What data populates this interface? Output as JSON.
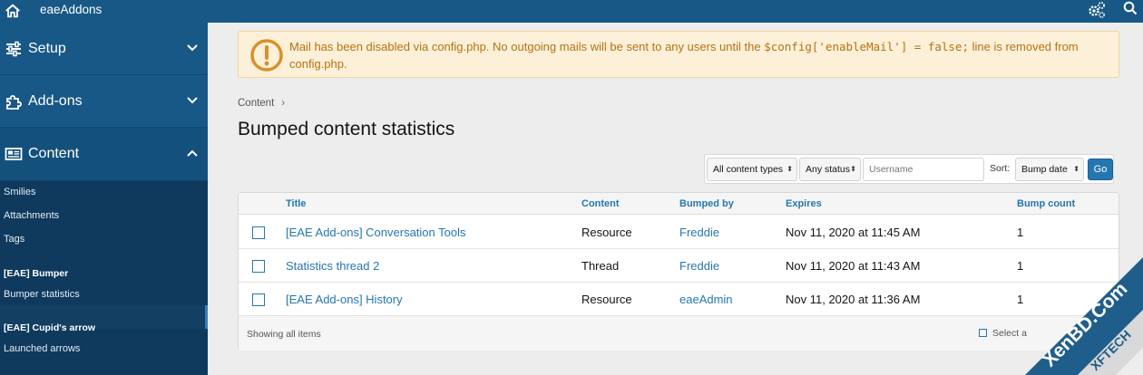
{
  "topbar": {
    "app_name": "eaeAddons"
  },
  "sidebar": {
    "sections": [
      {
        "label": "Setup",
        "icon": "sliders-icon"
      },
      {
        "label": "Add-ons",
        "icon": "puzzle-icon"
      },
      {
        "label": "Content",
        "icon": "newspaper-icon"
      }
    ],
    "items": [
      "Smilies",
      "Attachments",
      "Tags"
    ],
    "groups": [
      {
        "title": "[EAE] Bumper",
        "items": [
          "Bumper statistics"
        ]
      },
      {
        "title": "[EAE] Cupid's arrow",
        "items": [
          "Launched arrows"
        ]
      }
    ]
  },
  "alert": {
    "text_before": "Mail has been disabled via config.php. No outgoing mails will be sent to any users until the ",
    "code": "$config['enableMail'] = false;",
    "text_after": " line is removed from config.php."
  },
  "breadcrumb": "Content",
  "page_title": "Bumped content statistics",
  "filters": {
    "content_type": "All content types",
    "status": "Any status",
    "username_placeholder": "Username",
    "sort_label": "Sort:",
    "sort_value": "Bump date",
    "go_label": "Go"
  },
  "table": {
    "headers": [
      "Title",
      "Content",
      "Bumped by",
      "Expires",
      "Bump count"
    ],
    "rows": [
      {
        "title": "[EAE Add-ons] Conversation Tools",
        "content": "Resource",
        "bumped_by": "Freddie",
        "expires": "Nov 11, 2020 at 11:45 AM",
        "count": "1"
      },
      {
        "title": "Statistics thread 2",
        "content": "Thread",
        "bumped_by": "Freddie",
        "expires": "Nov 11, 2020 at 11:43 AM",
        "count": "1"
      },
      {
        "title": "[EAE Add-ons] History",
        "content": "Resource",
        "bumped_by": "eaeAdmin",
        "expires": "Nov 11, 2020 at 11:36 AM",
        "count": "1"
      }
    ],
    "footer": "Showing all items",
    "select_all": "Select a"
  },
  "watermark": {
    "line1": "XenBD.Com",
    "line2": "XFTECH"
  },
  "colors": {
    "topbar": "#185886",
    "sidebar": "#0f3a5e",
    "link": "#2577b1",
    "alert_text": "#b47212"
  }
}
